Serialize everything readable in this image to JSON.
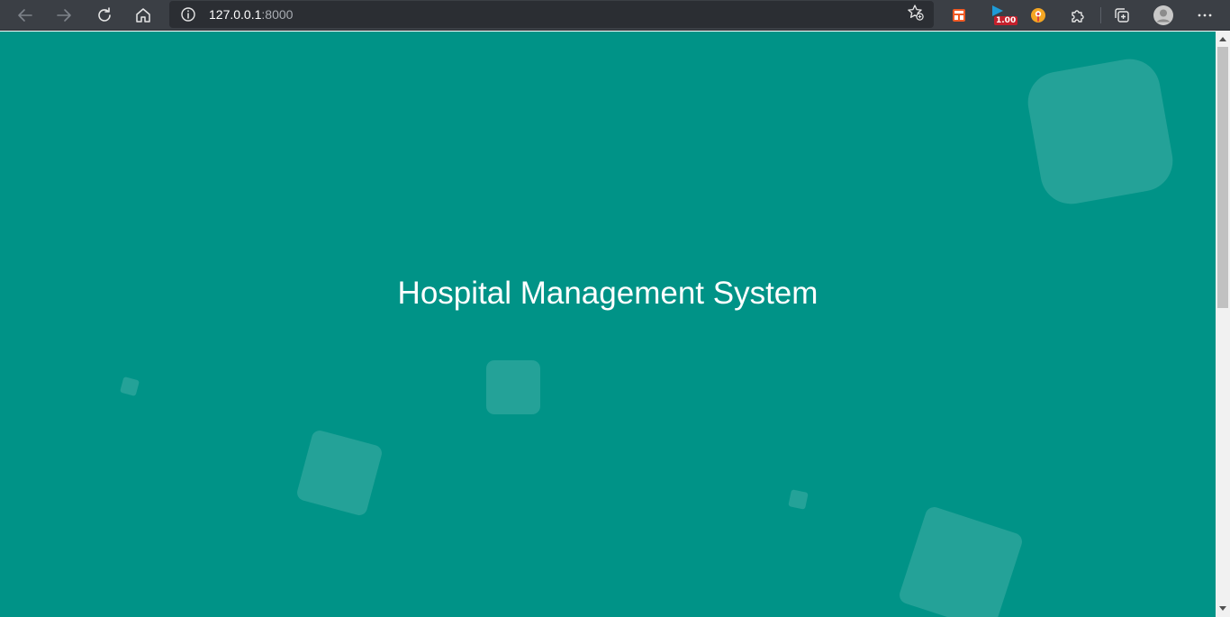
{
  "browser": {
    "address": {
      "host": "127.0.0.1",
      "port": ":8000"
    },
    "extension_badge": "1.00",
    "icons": {
      "back": "back-arrow-icon",
      "forward": "forward-arrow-icon",
      "refresh": "refresh-icon",
      "home": "home-icon",
      "site_info": "info-icon",
      "favorites": "add-favorite-icon",
      "extensions": "puzzle-icon",
      "collections": "collections-icon",
      "profile": "profile-avatar-icon",
      "menu": "more-menu-icon"
    },
    "colors": {
      "toolbar": "#3b3f45",
      "address_bar": "#2b2e33"
    }
  },
  "page": {
    "title": "Hospital Management System",
    "colors": {
      "background": "#009387",
      "title": "#ffffff"
    }
  }
}
